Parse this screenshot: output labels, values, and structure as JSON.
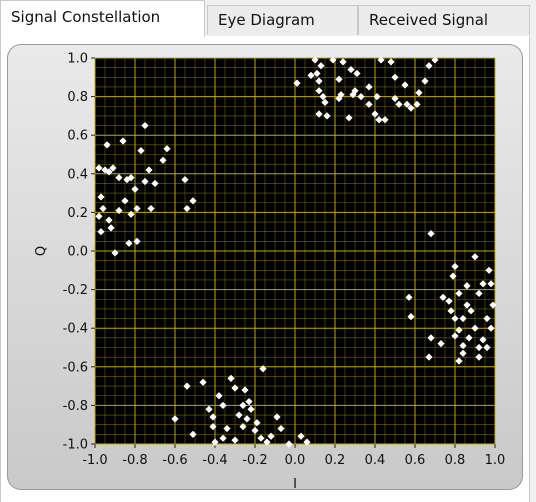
{
  "tabs": [
    {
      "label": "Signal Constellation",
      "active": true
    },
    {
      "label": "Eye Diagram",
      "active": false
    },
    {
      "label": "Received Signal",
      "active": false
    }
  ],
  "chart_data": {
    "type": "scatter",
    "xlabel": "I",
    "ylabel": "Q",
    "xlim": [
      -1.0,
      1.0
    ],
    "ylim": [
      -1.0,
      1.0
    ],
    "grid": true,
    "xticks": [
      -1.0,
      -0.8,
      -0.6,
      -0.4,
      -0.2,
      0.0,
      0.2,
      0.4,
      0.6,
      0.8,
      1.0
    ],
    "yticks": [
      1.0,
      0.8,
      0.6,
      0.4,
      0.2,
      0.0,
      -0.2,
      -0.4,
      -0.6,
      -0.8,
      -1.0
    ],
    "xtick_labels": [
      "-1.0",
      "-0.8",
      "-0.6",
      "-0.4",
      "-0.2",
      "0.0",
      "0.2",
      "0.4",
      "0.6",
      "0.8",
      "1.0"
    ],
    "ytick_labels": [
      "1.0",
      "0.8",
      "0.6",
      "0.4",
      "0.2",
      "0.0",
      "-0.2",
      "-0.4",
      "-0.6",
      "-0.8",
      "-1.0"
    ],
    "colors": {
      "background": "#000000",
      "grid": "#c8b400",
      "points": "#ffffff"
    },
    "points": [
      [
        -0.98,
        0.43
      ],
      [
        -0.95,
        0.42
      ],
      [
        -0.97,
        0.28
      ],
      [
        -0.94,
        0.55
      ],
      [
        -0.91,
        0.43
      ],
      [
        -0.88,
        0.38
      ],
      [
        -0.86,
        0.57
      ],
      [
        -0.84,
        0.37
      ],
      [
        -0.82,
        0.38
      ],
      [
        -0.8,
        0.32
      ],
      [
        -0.79,
        0.22
      ],
      [
        -0.82,
        0.19
      ],
      [
        -0.85,
        0.26
      ],
      [
        -0.88,
        0.21
      ],
      [
        -0.92,
        0.12
      ],
      [
        -0.96,
        0.22
      ],
      [
        -0.98,
        0.18
      ],
      [
        -0.93,
        0.16
      ],
      [
        -0.97,
        0.1
      ],
      [
        -0.9,
        -0.01
      ],
      [
        -0.83,
        0.04
      ],
      [
        -0.79,
        0.05
      ],
      [
        -0.75,
        0.65
      ],
      [
        -0.77,
        0.52
      ],
      [
        -0.73,
        0.42
      ],
      [
        -0.75,
        0.36
      ],
      [
        -0.7,
        0.35
      ],
      [
        -0.72,
        0.22
      ],
      [
        -0.66,
        0.47
      ],
      [
        -0.64,
        0.53
      ],
      [
        -0.55,
        0.37
      ],
      [
        -0.54,
        0.22
      ],
      [
        -0.51,
        0.26
      ],
      [
        -0.93,
        0.41
      ],
      [
        0.1,
        0.99
      ],
      [
        0.13,
        0.96
      ],
      [
        0.19,
        0.99
      ],
      [
        0.24,
        0.98
      ],
      [
        0.28,
        0.94
      ],
      [
        0.31,
        0.92
      ],
      [
        0.37,
        0.85
      ],
      [
        0.43,
        0.99
      ],
      [
        0.48,
        0.98
      ],
      [
        0.5,
        0.9
      ],
      [
        0.55,
        0.86
      ],
      [
        0.67,
        0.96
      ],
      [
        0.7,
        0.99
      ],
      [
        0.11,
        0.92
      ],
      [
        0.12,
        0.88
      ],
      [
        0.12,
        0.83
      ],
      [
        0.14,
        0.8
      ],
      [
        0.15,
        0.77
      ],
      [
        0.12,
        0.71
      ],
      [
        0.16,
        0.7
      ],
      [
        0.08,
        0.91
      ],
      [
        0.01,
        0.87
      ],
      [
        0.22,
        0.89
      ],
      [
        0.23,
        0.81
      ],
      [
        0.22,
        0.79
      ],
      [
        0.27,
        0.69
      ],
      [
        0.29,
        0.81
      ],
      [
        0.33,
        0.8
      ],
      [
        0.3,
        0.83
      ],
      [
        0.37,
        0.76
      ],
      [
        0.41,
        0.8
      ],
      [
        0.4,
        0.71
      ],
      [
        0.42,
        0.68
      ],
      [
        0.45,
        0.68
      ],
      [
        0.5,
        0.79
      ],
      [
        0.52,
        0.76
      ],
      [
        0.58,
        0.74
      ],
      [
        0.56,
        0.76
      ],
      [
        0.61,
        0.76
      ],
      [
        0.62,
        0.82
      ],
      [
        0.65,
        0.88
      ],
      [
        0.57,
        -0.24
      ],
      [
        0.58,
        -0.34
      ],
      [
        0.68,
        0.09
      ],
      [
        0.74,
        -0.24
      ],
      [
        0.8,
        -0.08
      ],
      [
        0.77,
        -0.26
      ],
      [
        0.78,
        -0.31
      ],
      [
        0.8,
        -0.35
      ],
      [
        0.82,
        -0.41
      ],
      [
        0.84,
        -0.35
      ],
      [
        0.86,
        -0.28
      ],
      [
        0.88,
        -0.31
      ],
      [
        0.92,
        -0.22
      ],
      [
        0.94,
        -0.17
      ],
      [
        0.97,
        -0.1
      ],
      [
        0.98,
        -0.17
      ],
      [
        0.99,
        -0.28
      ],
      [
        0.96,
        -0.35
      ],
      [
        0.98,
        -0.4
      ],
      [
        0.94,
        -0.46
      ],
      [
        0.92,
        -0.5
      ],
      [
        0.9,
        -0.4
      ],
      [
        0.87,
        -0.45
      ],
      [
        0.84,
        -0.49
      ],
      [
        0.82,
        -0.57
      ],
      [
        0.8,
        -0.44
      ],
      [
        0.73,
        -0.48
      ],
      [
        0.68,
        -0.45
      ],
      [
        0.67,
        -0.55
      ],
      [
        0.9,
        -0.03
      ],
      [
        0.92,
        -0.55
      ],
      [
        0.96,
        -0.5
      ],
      [
        0.84,
        -0.53
      ],
      [
        0.82,
        -0.22
      ],
      [
        0.79,
        -0.13
      ],
      [
        0.86,
        -0.18
      ],
      [
        -0.6,
        -0.87
      ],
      [
        -0.54,
        -0.7
      ],
      [
        -0.51,
        -0.95
      ],
      [
        -0.46,
        -0.68
      ],
      [
        -0.43,
        -0.82
      ],
      [
        -0.41,
        -0.86
      ],
      [
        -0.41,
        -0.91
      ],
      [
        -0.38,
        -0.75
      ],
      [
        -0.36,
        -0.8
      ],
      [
        -0.32,
        -0.66
      ],
      [
        -0.3,
        -0.71
      ],
      [
        -0.28,
        -0.85
      ],
      [
        -0.26,
        -0.8
      ],
      [
        -0.24,
        -0.87
      ],
      [
        -0.22,
        -0.82
      ],
      [
        -0.2,
        -0.93
      ],
      [
        -0.19,
        -0.89
      ],
      [
        -0.17,
        -0.97
      ],
      [
        -0.14,
        -0.99
      ],
      [
        -0.12,
        -0.96
      ],
      [
        -0.09,
        -0.86
      ],
      [
        -0.07,
        -0.92
      ],
      [
        -0.03,
        -1.0
      ],
      [
        0.03,
        -0.96
      ],
      [
        0.06,
        -0.99
      ],
      [
        -0.34,
        -0.92
      ],
      [
        -0.36,
        -0.97
      ],
      [
        -0.4,
        -0.99
      ],
      [
        -0.3,
        -0.98
      ],
      [
        -0.26,
        -0.91
      ],
      [
        -0.16,
        -0.61
      ],
      [
        -0.23,
        -0.78
      ],
      [
        -0.25,
        -0.72
      ]
    ]
  }
}
